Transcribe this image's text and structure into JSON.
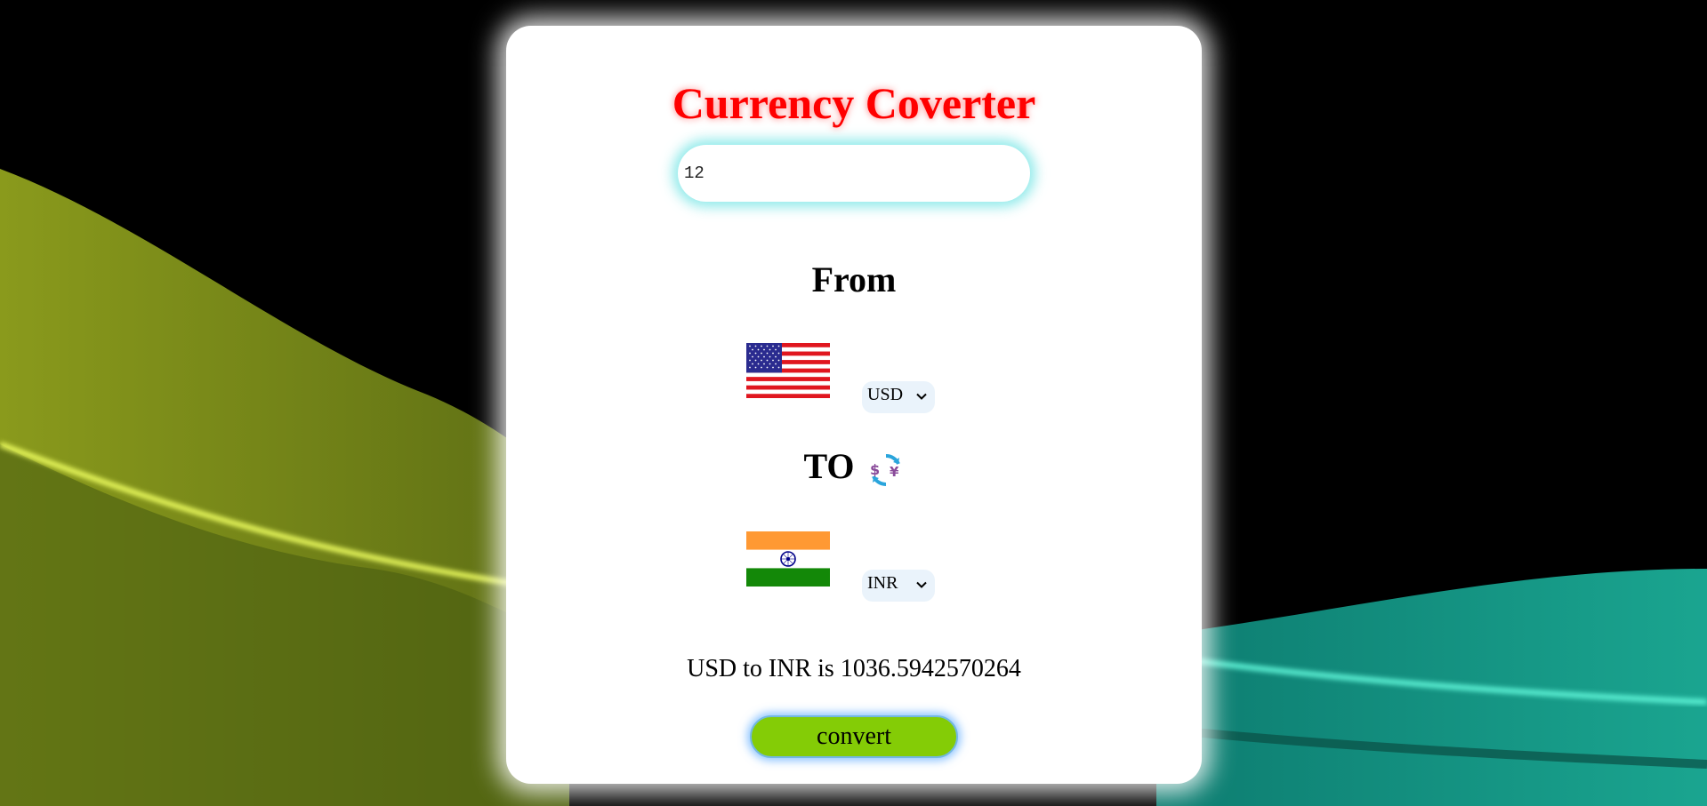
{
  "app": {
    "title": "Currency Coverter"
  },
  "amount_input": {
    "value": "12"
  },
  "from_section": {
    "label": "From",
    "flag": "us-flag",
    "currency": "USD"
  },
  "to_section": {
    "label": "TO",
    "icon": "currency-exchange-icon",
    "flag": "india-flag",
    "currency": "INR"
  },
  "result": {
    "text": "USD to INR is 1036.5942570264"
  },
  "convert_button": {
    "label": "convert"
  },
  "colors": {
    "title": "#ff0000",
    "button": "#84cc06",
    "select_bg": "#eaf3fb",
    "input_glow": "#46dcdc"
  }
}
